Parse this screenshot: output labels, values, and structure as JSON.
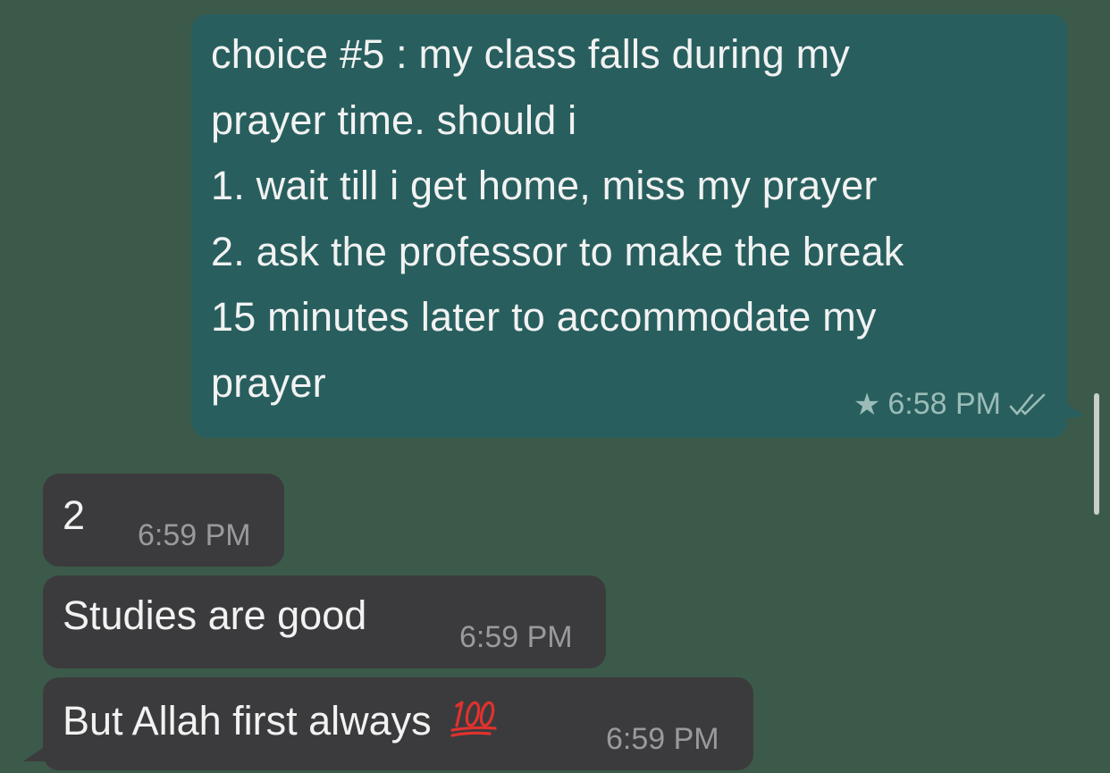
{
  "messages": [
    {
      "direction": "outgoing",
      "lines": [
        "choice #5 : my class falls during my",
        "prayer time. should i",
        "1. wait till i get home, miss my prayer",
        "2. ask the professor to make the break",
        "15 minutes later to accommodate my",
        "prayer"
      ],
      "time": "6:58 PM",
      "starred": true,
      "status": "read"
    },
    {
      "direction": "incoming",
      "text": "2",
      "time": "6:59 PM"
    },
    {
      "direction": "incoming",
      "text": "Studies are good",
      "time": "6:59 PM"
    },
    {
      "direction": "incoming",
      "text": "But Allah first always",
      "emoji": "hundred-points",
      "time": "6:59 PM"
    }
  ],
  "colors": {
    "background": "#3c5a4a",
    "outgoing_bubble": "#285f5e",
    "incoming_bubble": "#3b3b3d",
    "emoji_red": "#e0322e"
  },
  "icons": {
    "star": "star-icon",
    "read_receipt": "double-check-icon"
  }
}
